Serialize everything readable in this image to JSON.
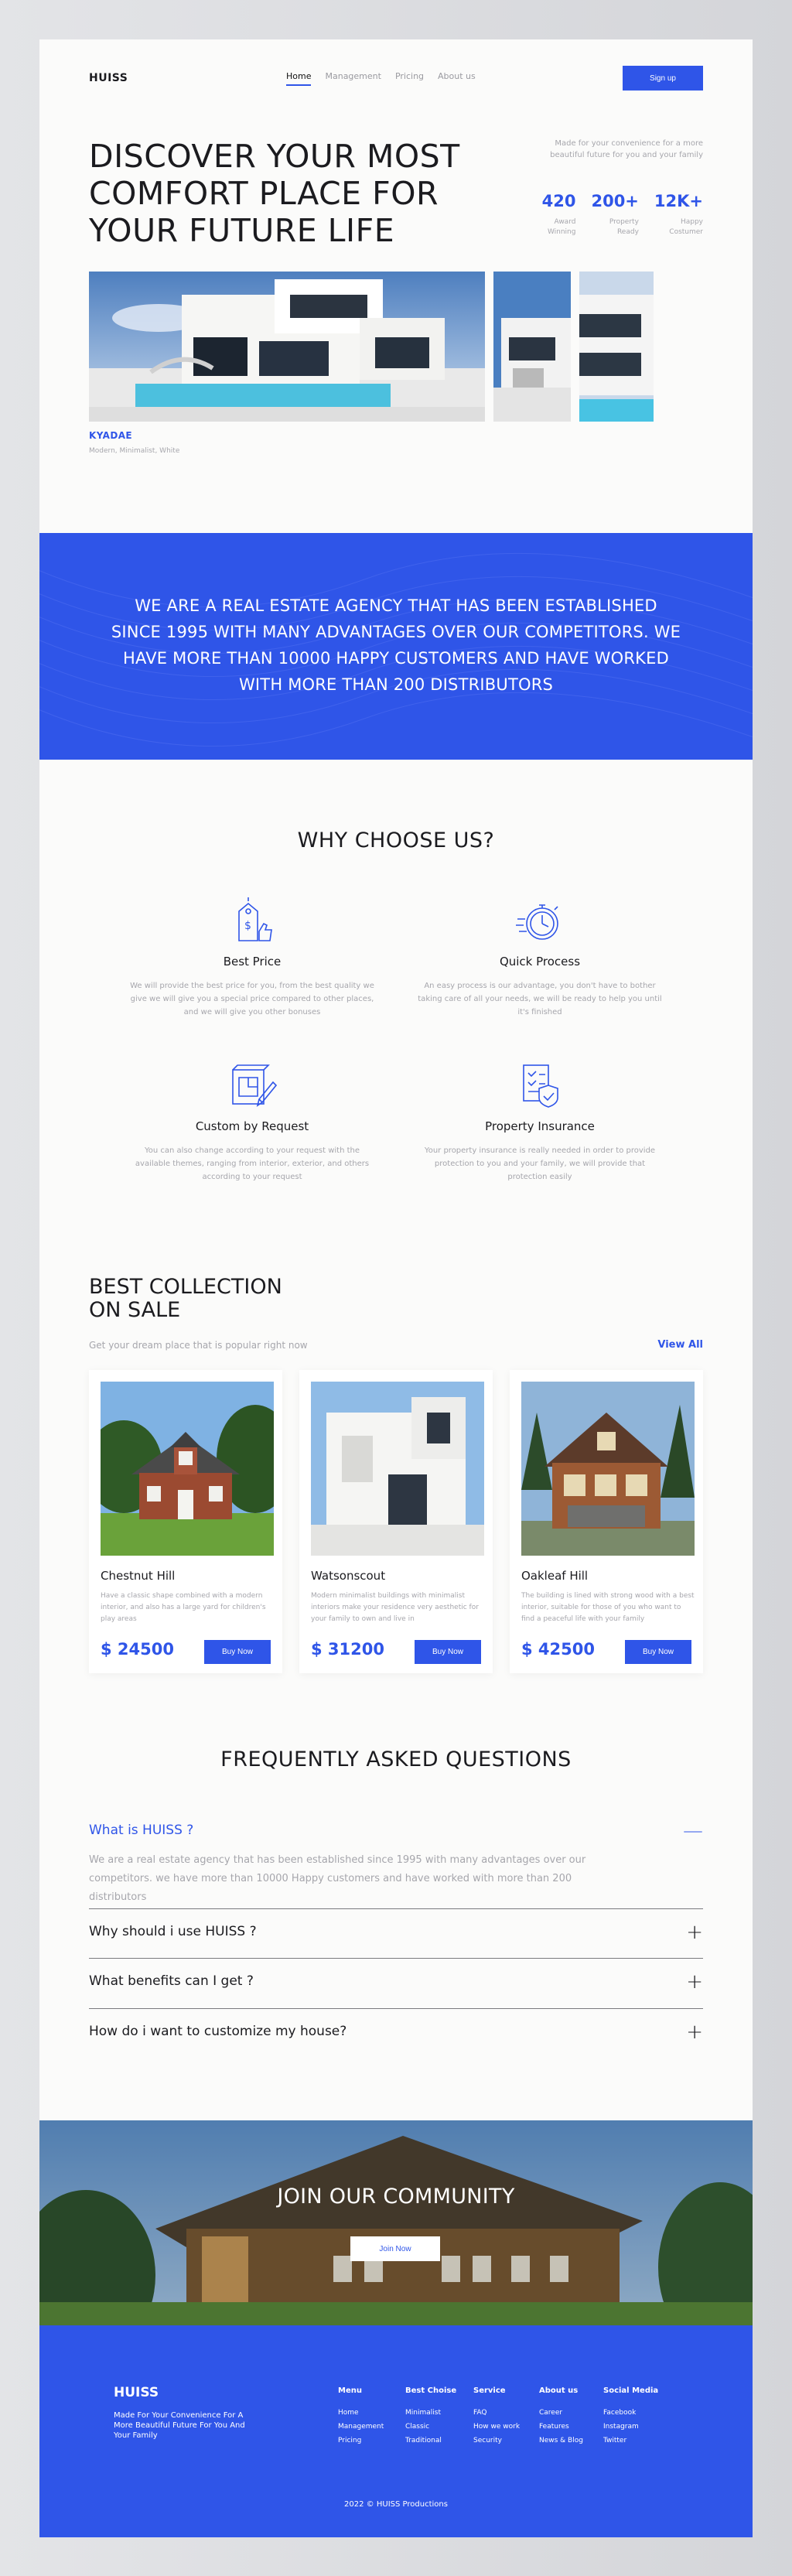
{
  "nav": {
    "logo": "HUISS",
    "links": [
      "Home",
      "Management",
      "Pricing",
      "About us"
    ],
    "signup": "Sign up"
  },
  "hero": {
    "title": "DISCOVER YOUR MOST COMFORT PLACE FOR YOUR FUTURE LIFE",
    "side_text": "Made for your convenience for a more beautiful future for you and your family",
    "stats": [
      {
        "value": "420",
        "label": "Award Winning"
      },
      {
        "value": "200+",
        "label": "Property Ready"
      },
      {
        "value": "12K+",
        "label": "Happy Costumer"
      }
    ],
    "caption_title": "KYADAE",
    "caption_sub": "Modern, Minimalist, White"
  },
  "about": {
    "text": "WE ARE A REAL ESTATE AGENCY THAT HAS BEEN ESTABLISHED SINCE 1995 WITH MANY ADVANTAGES OVER OUR COMPETITORS. WE HAVE MORE THAN 10000 HAPPY CUSTOMERS AND HAVE WORKED WITH MORE THAN 200 DISTRIBUTORS"
  },
  "why": {
    "title": "WHY CHOOSE US?",
    "features": [
      {
        "icon": "price-tag-icon",
        "title": "Best Price",
        "text": "We will provide the best price for you, from the best quality we give we will give you a special price compared to other places, and we will give you other bonuses"
      },
      {
        "icon": "stopwatch-icon",
        "title": "Quick Process",
        "text": "An easy process is our advantage, you don't have to bother taking care of all your needs, we will be ready to help you until it's finished"
      },
      {
        "icon": "blueprint-icon",
        "title": "Custom by Request",
        "text": "You can also change according to your request with the available themes, ranging from interior, exterior, and others according to your request"
      },
      {
        "icon": "insurance-document-icon",
        "title": "Property Insurance",
        "text": "Your property insurance is really needed in order to provide protection to you and your family, we will provide that protection easily"
      }
    ]
  },
  "collection": {
    "title_line1": "BEST COLLECTION",
    "title_line2": "ON SALE",
    "subtitle": "Get your dream place that is popular right now",
    "view_all": "View All",
    "buy_label": "Buy Now",
    "items": [
      {
        "name": "Chestnut Hill",
        "desc": "Have a classic shape combined with a modern interior, and also has a large yard for children's play areas",
        "price": "$ 24500"
      },
      {
        "name": "Watsonscout",
        "desc": "Modern minimalist buildings with minimalist interiors make your residence very aesthetic for your family to own and live in",
        "price": "$ 31200"
      },
      {
        "name": "Oakleaf Hill",
        "desc": "The building is lined with strong wood with a best interior, suitable for those of you who want to find a peaceful life with your family",
        "price": "$ 42500"
      }
    ]
  },
  "faq": {
    "title": "FREQUENTLY ASKED QUESTIONS",
    "items": [
      {
        "q": "What is HUISS ?",
        "a": "We are a real estate agency that has been established since 1995 with many advantages over our competitors. we have more than 10000 Happy customers and have worked with more than 200 distributors"
      },
      {
        "q": "Why should i use HUISS ?"
      },
      {
        "q": "What benefits can I get ?"
      },
      {
        "q": "How do i want to customize my house?"
      }
    ],
    "open_sign": "—",
    "closed_sign": "+"
  },
  "community": {
    "title": "JOIN OUR COMMUNITY",
    "button": "Join Now"
  },
  "footer": {
    "logo": "HUISS",
    "tagline": "Made For Your Convenience For A More Beautiful Future For You And Your Family",
    "columns": [
      {
        "title": "Menu",
        "links": [
          "Home",
          "Management",
          "Pricing"
        ]
      },
      {
        "title": "Best Choise",
        "links": [
          "Minimalist",
          "Classic",
          "Traditional"
        ]
      },
      {
        "title": "Service",
        "links": [
          "FAQ",
          "How we work",
          "Security"
        ]
      },
      {
        "title": "About us",
        "links": [
          "Career",
          "Features",
          "News & Blog"
        ]
      },
      {
        "title": "Social Media",
        "links": [
          "Facebook",
          "Instagram",
          "Twitter"
        ]
      }
    ],
    "copyright": "2022 © HUISS Productions"
  },
  "colors": {
    "accent": "#2f55e8",
    "background": "#fbfbfa",
    "muted": "#a6a6ac"
  }
}
